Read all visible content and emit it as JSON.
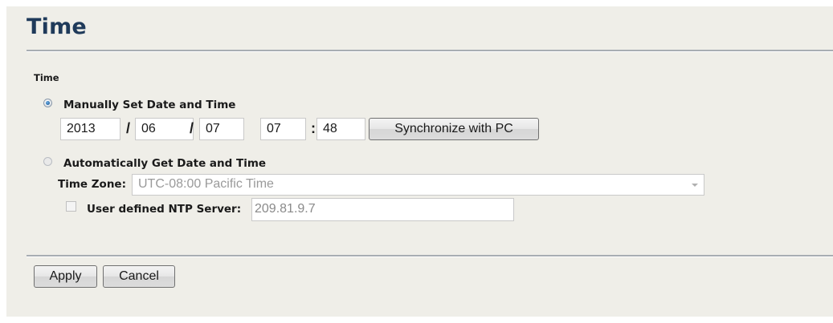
{
  "page": {
    "title": "Time"
  },
  "section": {
    "label": "Time"
  },
  "manual": {
    "label": "Manually Set Date and Time",
    "selected": true,
    "year": "2013",
    "month": "06",
    "day": "07",
    "hour": "07",
    "minute": "48",
    "date_separator": "/",
    "time_separator": ":",
    "sync_button": "Synchronize with PC"
  },
  "automatic": {
    "label": "Automatically Get Date and Time",
    "selected": false,
    "timezone_label": "Time Zone:",
    "timezone_value": "UTC-08:00 Pacific Time",
    "ntp_checkbox_checked": false,
    "ntp_label": "User defined NTP Server:",
    "ntp_value": "209.81.9.7"
  },
  "footer": {
    "apply_label": "Apply",
    "cancel_label": "Cancel"
  },
  "colors": {
    "title": "#1f3a5a",
    "panel_bg": "#efeee8",
    "rule": "#a8adb3"
  }
}
